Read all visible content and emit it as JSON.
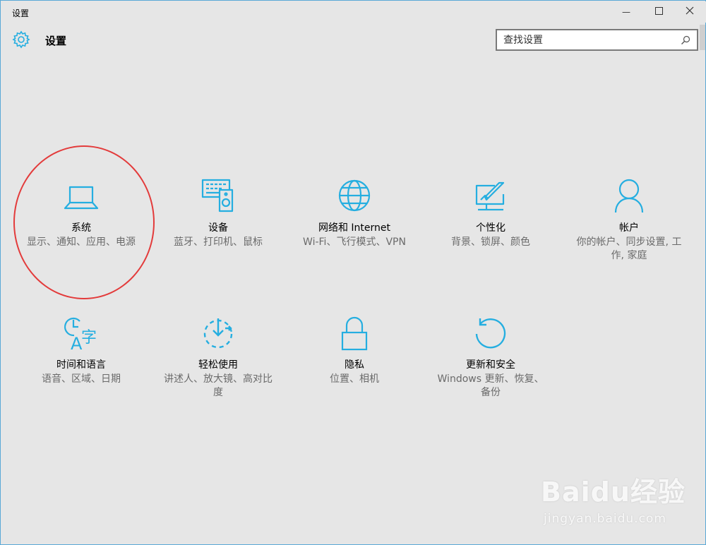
{
  "window": {
    "title": "设置",
    "minimize_glyph": "—",
    "maximize_glyph": "☐",
    "close_glyph": "✕"
  },
  "header": {
    "title": "设置",
    "icon": "gear-icon"
  },
  "search": {
    "placeholder": "查找设置",
    "value": "",
    "icon": "search-icon"
  },
  "colors": {
    "accent": "#25aee0",
    "highlight_circle": "#e33b3b",
    "background": "#e6e6e6"
  },
  "tiles": [
    {
      "name": "系统",
      "desc": "显示、通知、应用、电源",
      "icon": "laptop-icon"
    },
    {
      "name": "设备",
      "desc": "蓝牙、打印机、鼠标",
      "icon": "devices-icon"
    },
    {
      "name": "网络和 Internet",
      "desc": "Wi-Fi、飞行模式、VPN",
      "icon": "globe-icon"
    },
    {
      "name": "个性化",
      "desc": "背景、锁屏、颜色",
      "icon": "personalization-icon"
    },
    {
      "name": "帐户",
      "desc": "你的帐户、同步设置, 工作, 家庭",
      "icon": "person-icon"
    },
    {
      "name": "时间和语言",
      "desc": "语音、区域、日期",
      "icon": "time-language-icon"
    },
    {
      "name": "轻松使用",
      "desc": "讲述人、放大镜、高对比度",
      "icon": "ease-of-access-icon"
    },
    {
      "name": "隐私",
      "desc": "位置、相机",
      "icon": "lock-icon"
    },
    {
      "name": "更新和安全",
      "desc": "Windows 更新、恢复、备份",
      "icon": "update-icon"
    }
  ],
  "watermark": {
    "logo": "Baidu经验",
    "url": "jingyan.baidu.com"
  }
}
